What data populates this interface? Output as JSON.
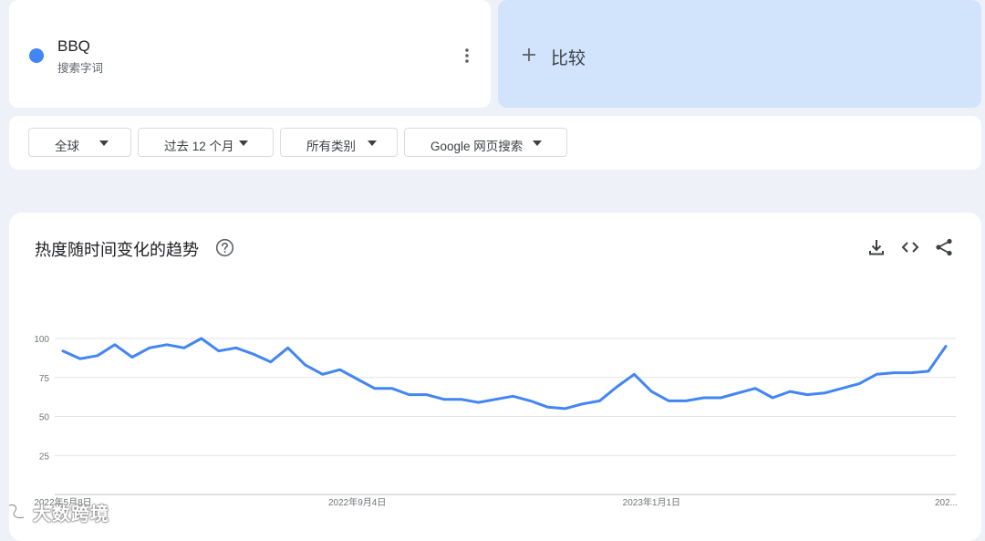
{
  "term": {
    "name": "BBQ",
    "subtitle": "搜索字词",
    "color": "#4285f4",
    "more_icon": "more-vert-icon"
  },
  "compare": {
    "label": "比较",
    "icon": "plus-icon",
    "background": "#d2e3fc"
  },
  "filters": [
    {
      "label": "全球"
    },
    {
      "label": "过去 12 个月"
    },
    {
      "label": "所有类别"
    },
    {
      "label": "Google 网页搜索"
    }
  ],
  "chart_card": {
    "title": "热度随时间变化的趋势",
    "help_icon": "help-circle-icon",
    "actions": [
      "download-icon",
      "embed-code-icon",
      "share-icon"
    ]
  },
  "chart_data": {
    "type": "line",
    "title": "热度随时间变化的趋势",
    "ylim": [
      0,
      100
    ],
    "y_ticks": [
      100,
      75,
      50,
      25
    ],
    "x_tick_labels": [
      "2022年5月8日",
      "2022年9月4日",
      "2023年1月1日",
      "202..."
    ],
    "x_tick_indices": [
      0,
      17,
      34,
      51
    ],
    "grid": true,
    "legend": "none",
    "series": [
      {
        "color": "#4285f4",
        "values": [
          92,
          87,
          89,
          96,
          88,
          94,
          96,
          94,
          100,
          92,
          94,
          90,
          85,
          94,
          83,
          77,
          80,
          74,
          68,
          68,
          64,
          64,
          61,
          61,
          59,
          61,
          63,
          60,
          56,
          55,
          58,
          60,
          69,
          77,
          66,
          60,
          60,
          62,
          62,
          65,
          68,
          62,
          66,
          64,
          65,
          68,
          71,
          77,
          78,
          78,
          79,
          95
        ]
      }
    ]
  },
  "watermark": {
    "text": "大数跨境"
  }
}
